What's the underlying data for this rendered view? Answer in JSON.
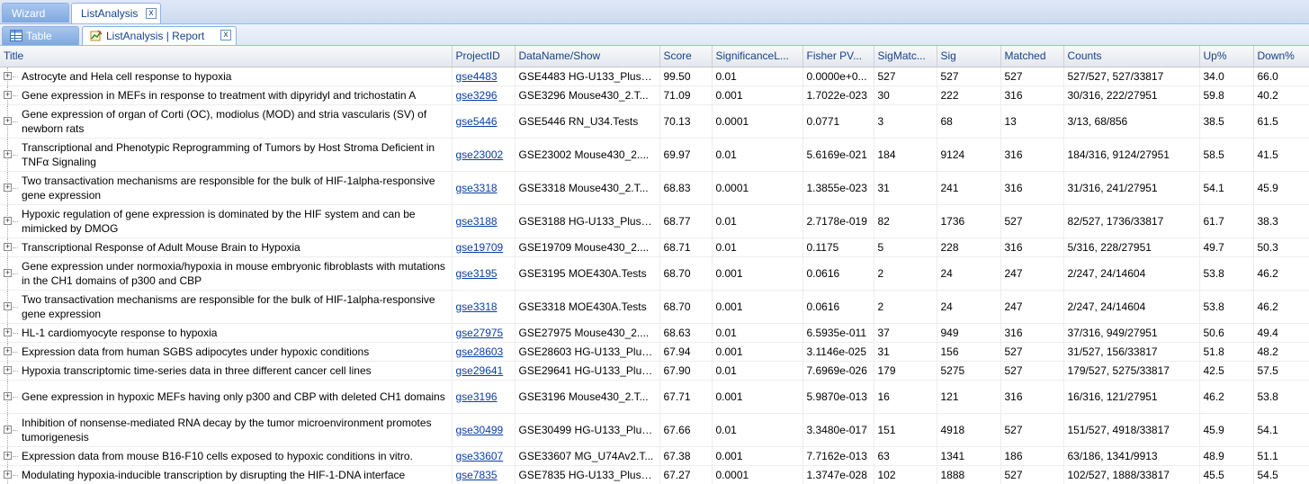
{
  "top_tabs": [
    {
      "label": "Wizard"
    },
    {
      "label": "ListAnalysis",
      "close": "x"
    }
  ],
  "sub_tabs": [
    {
      "label": "Table",
      "icon": "table-icon"
    },
    {
      "label": "ListAnalysis | Report",
      "icon": "report-icon",
      "close": "x"
    }
  ],
  "columns": [
    "Title",
    "ProjectID",
    "DataName/Show",
    "Score",
    "SignificanceL...",
    "Fisher PV...",
    "SigMatc...",
    "Sig",
    "Matched",
    "Counts",
    "Up%",
    "Down%"
  ],
  "rows": [
    {
      "title": "Astrocyte and Hela cell response to hypoxia",
      "project": "gse4483",
      "dataname": "GSE4483 HG-U133_Plus_...",
      "score": "99.50",
      "signif": "0.01",
      "fisher": "0.0000e+0...",
      "sigmatch": "527",
      "sig": "527",
      "matched": "527",
      "counts": "527/527, 527/33817",
      "up": "34.0",
      "down": "66.0",
      "tall": false
    },
    {
      "title": "Gene expression in MEFs in response to treatment with dipyridyl and trichostatin A",
      "project": "gse3296",
      "dataname": "GSE3296 Mouse430_2.T...",
      "score": "71.09",
      "signif": "0.001",
      "fisher": "1.7022e-023",
      "sigmatch": "30",
      "sig": "222",
      "matched": "316",
      "counts": "30/316, 222/27951",
      "up": "59.8",
      "down": "40.2",
      "tall": false
    },
    {
      "title": "Gene expression of organ of Corti (OC), modiolus (MOD) and stria vascularis (SV) of newborn rats",
      "project": "gse5446",
      "dataname": "GSE5446 RN_U34.Tests",
      "score": "70.13",
      "signif": "0.0001",
      "fisher": "0.0771",
      "sigmatch": "3",
      "sig": "68",
      "matched": "13",
      "counts": "3/13, 68/856",
      "up": "38.5",
      "down": "61.5",
      "tall": true
    },
    {
      "title": "Transcriptional and Phenotypic Reprogramming of Tumors by Host Stroma Deficient in TNFα Signaling",
      "project": "gse23002",
      "dataname": "GSE23002 Mouse430_2....",
      "score": "69.97",
      "signif": "0.01",
      "fisher": "5.6169e-021",
      "sigmatch": "184",
      "sig": "9124",
      "matched": "316",
      "counts": "184/316, 9124/27951",
      "up": "58.5",
      "down": "41.5",
      "tall": true
    },
    {
      "title": "Two transactivation mechanisms are responsible for the bulk of HIF-1alpha-responsive gene expression",
      "project": "gse3318",
      "dataname": "GSE3318 Mouse430_2.T...",
      "score": "68.83",
      "signif": "0.0001",
      "fisher": "1.3855e-023",
      "sigmatch": "31",
      "sig": "241",
      "matched": "316",
      "counts": "31/316, 241/27951",
      "up": "54.1",
      "down": "45.9",
      "tall": true
    },
    {
      "title": "Hypoxic regulation of gene expression is dominated by the HIF system and can be mimicked by DMOG",
      "project": "gse3188",
      "dataname": "GSE3188 HG-U133_Plus_...",
      "score": "68.77",
      "signif": "0.01",
      "fisher": "2.7178e-019",
      "sigmatch": "82",
      "sig": "1736",
      "matched": "527",
      "counts": "82/527, 1736/33817",
      "up": "61.7",
      "down": "38.3",
      "tall": true
    },
    {
      "title": "Transcriptional Response of Adult Mouse Brain to Hypoxia",
      "project": "gse19709",
      "dataname": "GSE19709 Mouse430_2....",
      "score": "68.71",
      "signif": "0.01",
      "fisher": "0.1175",
      "sigmatch": "5",
      "sig": "228",
      "matched": "316",
      "counts": "5/316, 228/27951",
      "up": "49.7",
      "down": "50.3",
      "tall": false
    },
    {
      "title": "Gene expression under normoxia/hypoxia in mouse embryonic fibroblasts with mutations in the CH1 domains of p300 and CBP",
      "project": "gse3195",
      "dataname": "GSE3195 MOE430A.Tests",
      "score": "68.70",
      "signif": "0.001",
      "fisher": "0.0616",
      "sigmatch": "2",
      "sig": "24",
      "matched": "247",
      "counts": "2/247, 24/14604",
      "up": "53.8",
      "down": "46.2",
      "tall": true
    },
    {
      "title": "Two transactivation mechanisms are responsible for the bulk of HIF-1alpha-responsive gene expression",
      "project": "gse3318",
      "dataname": "GSE3318 MOE430A.Tests",
      "score": "68.70",
      "signif": "0.001",
      "fisher": "0.0616",
      "sigmatch": "2",
      "sig": "24",
      "matched": "247",
      "counts": "2/247, 24/14604",
      "up": "53.8",
      "down": "46.2",
      "tall": true
    },
    {
      "title": "HL-1 cardiomyocyte response to hypoxia",
      "project": "gse27975",
      "dataname": "GSE27975 Mouse430_2....",
      "score": "68.63",
      "signif": "0.01",
      "fisher": "6.5935e-011",
      "sigmatch": "37",
      "sig": "949",
      "matched": "316",
      "counts": "37/316, 949/27951",
      "up": "50.6",
      "down": "49.4",
      "tall": false
    },
    {
      "title": "Expression data from human SGBS adipocytes under hypoxic conditions",
      "project": "gse28603",
      "dataname": "GSE28603 HG-U133_Plus...",
      "score": "67.94",
      "signif": "0.001",
      "fisher": "3.1146e-025",
      "sigmatch": "31",
      "sig": "156",
      "matched": "527",
      "counts": "31/527, 156/33817",
      "up": "51.8",
      "down": "48.2",
      "tall": false
    },
    {
      "title": "Hypoxia transcriptomic time-series data in three different cancer cell lines",
      "project": "gse29641",
      "dataname": "GSE29641 HG-U133_Plus...",
      "score": "67.90",
      "signif": "0.01",
      "fisher": "7.6969e-026",
      "sigmatch": "179",
      "sig": "5275",
      "matched": "527",
      "counts": "179/527, 5275/33817",
      "up": "42.5",
      "down": "57.5",
      "tall": false
    },
    {
      "title": "Gene expression in hypoxic MEFs having only p300 and CBP with deleted CH1 domains",
      "project": "gse3196",
      "dataname": "GSE3196 Mouse430_2.T...",
      "score": "67.71",
      "signif": "0.001",
      "fisher": "5.9870e-013",
      "sigmatch": "16",
      "sig": "121",
      "matched": "316",
      "counts": "16/316, 121/27951",
      "up": "46.2",
      "down": "53.8",
      "tall": true
    },
    {
      "title": "Inhibition of nonsense-mediated RNA decay by the tumor microenvironment promotes tumorigenesis",
      "project": "gse30499",
      "dataname": "GSE30499 HG-U133_Plus...",
      "score": "67.66",
      "signif": "0.01",
      "fisher": "3.3480e-017",
      "sigmatch": "151",
      "sig": "4918",
      "matched": "527",
      "counts": "151/527, 4918/33817",
      "up": "45.9",
      "down": "54.1",
      "tall": true
    },
    {
      "title": "Expression data from mouse B16-F10 cells exposed to hypoxic conditions in vitro.",
      "project": "gse33607",
      "dataname": "GSE33607 MG_U74Av2.T...",
      "score": "67.38",
      "signif": "0.001",
      "fisher": "7.7162e-013",
      "sigmatch": "63",
      "sig": "1341",
      "matched": "186",
      "counts": "63/186, 1341/9913",
      "up": "48.9",
      "down": "51.1",
      "tall": false
    },
    {
      "title": "Modulating hypoxia-inducible transcription by disrupting the HIF-1-DNA interface",
      "project": "gse7835",
      "dataname": "GSE7835 HG-U133_Plus_...",
      "score": "67.27",
      "signif": "0.0001",
      "fisher": "1.3747e-028",
      "sigmatch": "102",
      "sig": "1888",
      "matched": "527",
      "counts": "102/527, 1888/33817",
      "up": "45.5",
      "down": "54.5",
      "tall": false
    }
  ]
}
